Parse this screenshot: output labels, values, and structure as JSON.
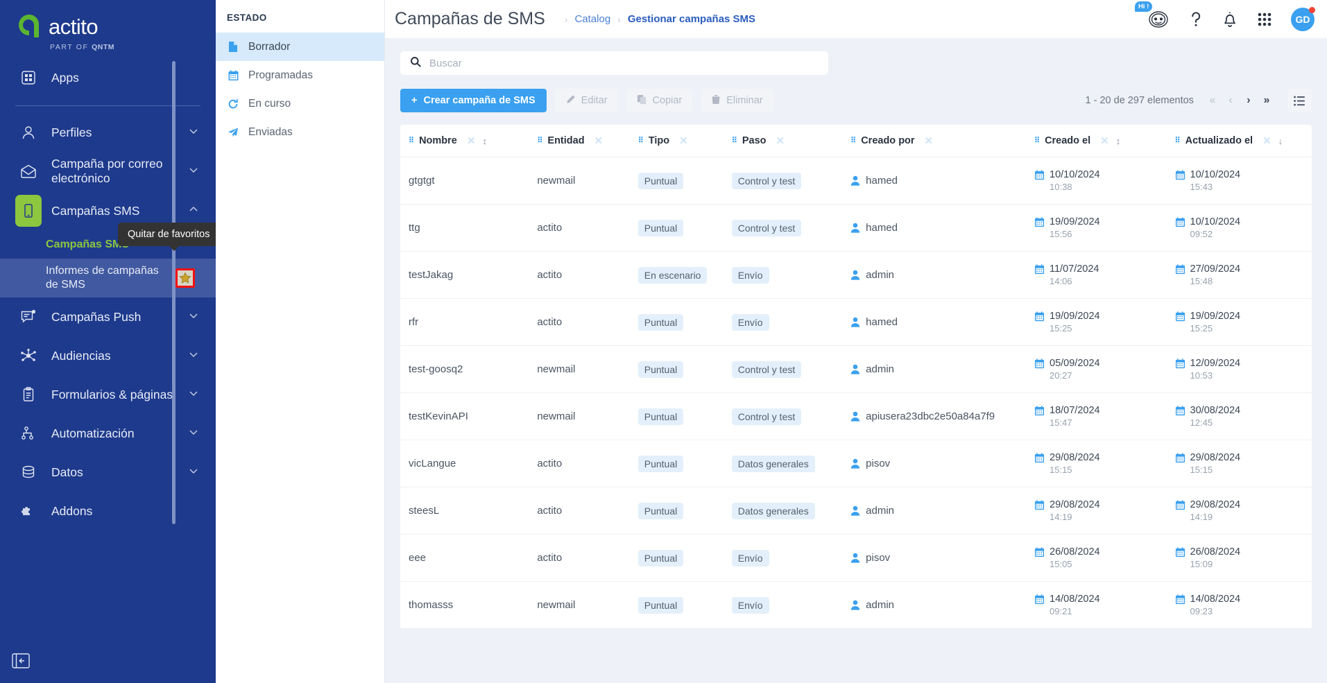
{
  "brand": {
    "name": "actito",
    "tagline_prefix": "PART OF",
    "tagline_brand": "QNTM",
    "green": "#8dc63f",
    "navy": "#1e3a8c",
    "accent": "#3aa0ef"
  },
  "sidebar": {
    "items": [
      {
        "label": "Apps",
        "icon": "apps-grid-icon",
        "chevron": ""
      },
      {
        "label": "Perfiles",
        "icon": "person-icon",
        "chevron": "⌄"
      },
      {
        "label": "Campaña por correo electrónico",
        "icon": "envelope-icon",
        "chevron": "⌄"
      },
      {
        "label": "Campañas SMS",
        "icon": "mobile-icon",
        "chevron": "⌃"
      },
      {
        "label": "Campañas Push",
        "icon": "push-message-icon",
        "chevron": "⌄"
      },
      {
        "label": "Audiencias",
        "icon": "audience-network-icon",
        "chevron": "⌄"
      },
      {
        "label": "Formularios & páginas",
        "icon": "clipboard-icon",
        "chevron": "⌄"
      },
      {
        "label": "Automatización",
        "icon": "hierarchy-icon",
        "chevron": "⌄"
      },
      {
        "label": "Datos",
        "icon": "database-icon",
        "chevron": "⌄"
      },
      {
        "label": "Addons",
        "icon": "puzzle-icon",
        "chevron": ""
      }
    ],
    "subitems": [
      {
        "label": "Campañas SMS"
      },
      {
        "label": "Informes de campañas de SMS"
      }
    ],
    "tooltip": "Quitar de favoritos"
  },
  "header": {
    "title": "Campañas de SMS",
    "breadcrumb": [
      "Catalog",
      "Gestionar campañas SMS"
    ],
    "chat_badge": "Hi !",
    "avatar_initials": "GD"
  },
  "estado": {
    "title": "ESTADO",
    "items": [
      {
        "label": "Borrador",
        "icon": "document-icon",
        "selected": true
      },
      {
        "label": "Programadas",
        "icon": "calendar-icon",
        "selected": false
      },
      {
        "label": "En curso",
        "icon": "refresh-icon",
        "selected": false
      },
      {
        "label": "Enviadas",
        "icon": "paper-plane-icon",
        "selected": false
      }
    ]
  },
  "search": {
    "placeholder": "Buscar",
    "value": ""
  },
  "toolbar": {
    "create_label": "Crear campaña de SMS",
    "edit_label": "Editar",
    "copy_label": "Copiar",
    "delete_label": "Eliminar",
    "pagination_text": "1 - 20 de 297 elementos"
  },
  "table": {
    "columns": [
      {
        "label": "Nombre",
        "sortable": true
      },
      {
        "label": "Entidad",
        "sortable": false
      },
      {
        "label": "Tipo",
        "sortable": false
      },
      {
        "label": "Paso",
        "sortable": false
      },
      {
        "label": "Creado por",
        "sortable": false
      },
      {
        "label": "Creado el",
        "sortable": true
      },
      {
        "label": "Actualizado el",
        "sortable": true,
        "sort_active": "desc"
      }
    ],
    "rows": [
      {
        "nombre": "gtgtgt",
        "entidad": "newmail",
        "tipo": "Puntual",
        "paso": "Control y test",
        "creado_por": "hamed",
        "creado_el": "10/10/2024",
        "creado_hora": "10:38",
        "actualizado_el": "10/10/2024",
        "actualizado_hora": "15:43"
      },
      {
        "nombre": "ttg",
        "entidad": "actito",
        "tipo": "Puntual",
        "paso": "Control y test",
        "creado_por": "hamed",
        "creado_el": "19/09/2024",
        "creado_hora": "15:56",
        "actualizado_el": "10/10/2024",
        "actualizado_hora": "09:52"
      },
      {
        "nombre": "testJakag",
        "entidad": "actito",
        "tipo": "En escenario",
        "paso": "Envío",
        "creado_por": "admin",
        "creado_el": "11/07/2024",
        "creado_hora": "14:06",
        "actualizado_el": "27/09/2024",
        "actualizado_hora": "15:48"
      },
      {
        "nombre": "rfr",
        "entidad": "actito",
        "tipo": "Puntual",
        "paso": "Envío",
        "creado_por": "hamed",
        "creado_el": "19/09/2024",
        "creado_hora": "15:25",
        "actualizado_el": "19/09/2024",
        "actualizado_hora": "15:25"
      },
      {
        "nombre": "test-goosq2",
        "entidad": "newmail",
        "tipo": "Puntual",
        "paso": "Control y test",
        "creado_por": "admin",
        "creado_el": "05/09/2024",
        "creado_hora": "20:27",
        "actualizado_el": "12/09/2024",
        "actualizado_hora": "10:53"
      },
      {
        "nombre": "testKevinAPI",
        "entidad": "newmail",
        "tipo": "Puntual",
        "paso": "Control y test",
        "creado_por": "apiusera23dbc2e50a84a7f9",
        "creado_el": "18/07/2024",
        "creado_hora": "15:47",
        "actualizado_el": "30/08/2024",
        "actualizado_hora": "12:45"
      },
      {
        "nombre": "vicLangue",
        "entidad": "actito",
        "tipo": "Puntual",
        "paso": "Datos generales",
        "creado_por": "pisov",
        "creado_el": "29/08/2024",
        "creado_hora": "15:15",
        "actualizado_el": "29/08/2024",
        "actualizado_hora": "15:15"
      },
      {
        "nombre": "steesL",
        "entidad": "actito",
        "tipo": "Puntual",
        "paso": "Datos generales",
        "creado_por": "admin",
        "creado_el": "29/08/2024",
        "creado_hora": "14:19",
        "actualizado_el": "29/08/2024",
        "actualizado_hora": "14:19"
      },
      {
        "nombre": "eee",
        "entidad": "actito",
        "tipo": "Puntual",
        "paso": "Envío",
        "creado_por": "pisov",
        "creado_el": "26/08/2024",
        "creado_hora": "15:05",
        "actualizado_el": "26/08/2024",
        "actualizado_hora": "15:09"
      },
      {
        "nombre": "thomasss",
        "entidad": "newmail",
        "tipo": "Puntual",
        "paso": "Envío",
        "creado_por": "admin",
        "creado_el": "14/08/2024",
        "creado_hora": "09:21",
        "actualizado_el": "14/08/2024",
        "actualizado_hora": "09:23"
      }
    ]
  }
}
